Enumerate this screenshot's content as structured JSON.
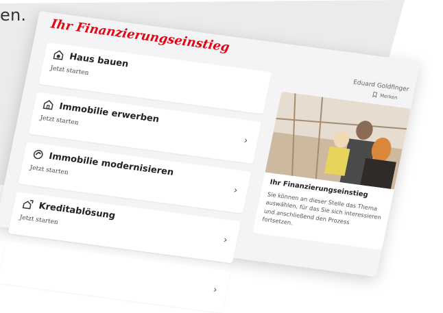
{
  "background_text": "en.",
  "title": "Ihr Finanzierungseinstieg",
  "accent_color": "#e30613",
  "user": {
    "name": "Eduard Goldfinger",
    "merken_label": "Merken",
    "merken_icon": "bookmark-hand-icon"
  },
  "cards": [
    {
      "title": "Haus bauen",
      "subtitle": "Jetzt starten",
      "icon": "house-build-icon",
      "chevron": ""
    },
    {
      "title": "Immobilie erwerben",
      "subtitle": "Jetzt starten",
      "icon": "house-icon",
      "chevron": "›"
    },
    {
      "title": "Immobilie modernisieren",
      "subtitle": "Jetzt starten",
      "icon": "renovation-icon",
      "chevron": "›"
    },
    {
      "title": "Kreditablösung",
      "subtitle": "Jetzt starten",
      "icon": "credit-replacement-icon",
      "chevron": "›"
    },
    {
      "title": "",
      "subtitle": "",
      "icon": "",
      "chevron": "›"
    }
  ],
  "info_card": {
    "title": "Ihr Finanzierungseinstieg",
    "text": "Sie können an dieser Stelle das Thema auswählen, für das Sie sich interessieren und anschließend den Prozess fortsetzen.",
    "image": "family-photo"
  }
}
